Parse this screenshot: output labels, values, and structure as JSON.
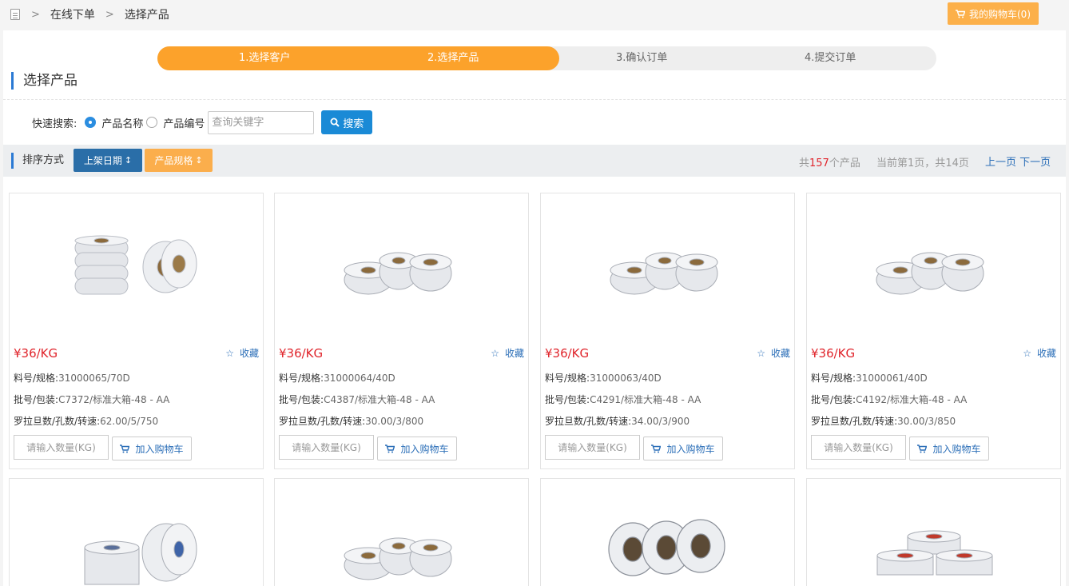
{
  "breadcrumb": {
    "icon": "document-icon",
    "items": [
      "在线下单",
      "选择产品"
    ]
  },
  "cart_button": {
    "label": "我的购物车(0)",
    "icon": "cart-icon"
  },
  "steps": [
    "1.选择客户",
    "2.选择产品",
    "3.确认订单",
    "4.提交订单"
  ],
  "active_step_count": 2,
  "section_title": "选择产品",
  "search": {
    "label": "快速搜索:",
    "options": [
      "产品名称",
      "产品编号"
    ],
    "selected": "产品名称",
    "placeholder": "查询关键字",
    "button": "搜索"
  },
  "sort": {
    "label": "排序方式",
    "buttons": [
      "上架日期",
      "产品规格"
    ],
    "total_prefix": "共",
    "total": "157",
    "total_suffix": "个产品",
    "page_prefix": "当前第",
    "current_page": "1",
    "page_mid": "页，共",
    "total_pages": "14",
    "page_suffix": "页",
    "prev": "上一页",
    "next": "下一页"
  },
  "card_labels": {
    "fav": "收藏",
    "spec": "料号/规格:",
    "batch": "批号/包装:",
    "denier": "罗拉旦数/孔数/转速:",
    "qty_placeholder": "请输入数量(KG)",
    "add_cart": "加入购物车"
  },
  "products": [
    {
      "price": "¥36/KG",
      "spec": "31000065/70D",
      "batch": "C7372/标准大箱-48 - AA",
      "denier": "62.00/5/750"
    },
    {
      "price": "¥36/KG",
      "spec": "31000064/40D",
      "batch": "C4387/标准大箱-48 - AA",
      "denier": "30.00/3/800"
    },
    {
      "price": "¥36/KG",
      "spec": "31000063/40D",
      "batch": "C4291/标准大箱-48 - AA",
      "denier": "34.00/3/900"
    },
    {
      "price": "¥36/KG",
      "spec": "31000061/40D",
      "batch": "C4192/标准大箱-48 - AA",
      "denier": "30.00/3/850"
    }
  ],
  "colors": {
    "accent_orange": "#fca22b",
    "primary_blue": "#2a6ea8",
    "price_red": "#e0242b",
    "link_blue": "#2c6fb8"
  }
}
